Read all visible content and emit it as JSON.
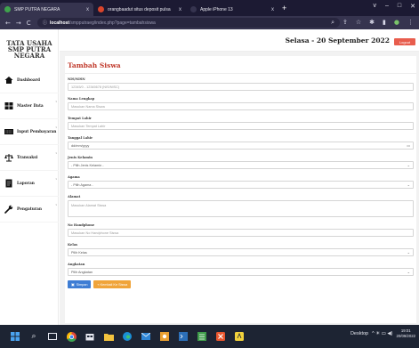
{
  "browser": {
    "tabs": [
      {
        "label": "SMP PUTRA NEGARA",
        "close": "x",
        "favicon_color": "#3fa34d"
      },
      {
        "label": "orangbaadut situs deposit pulsa",
        "close": "x",
        "favicon_color": "#d9452b"
      },
      {
        "label": "Apple iPhone 13",
        "close": "x",
        "favicon_color": "#36344f"
      }
    ],
    "new_tab": "+",
    "window_controls": [
      "v",
      "–",
      "□",
      "✕"
    ],
    "url_host": "localhost",
    "url_path": "/smpputraeg/index.php?page=tambahsiswa",
    "nav": [
      "←",
      "→",
      "C",
      "ⓘ"
    ],
    "toolbar_icons": [
      "search-icon",
      "share-icon",
      "star-icon",
      "extensions-icon",
      "sidebar-icon",
      "profile-icon",
      "menu-icon"
    ]
  },
  "sidebar": {
    "brand": "TATA USAHA SMP PUTRA NEGARA",
    "items": [
      {
        "label": "Dashboard",
        "icon": "home-icon",
        "caret": ""
      },
      {
        "label": "Master Data",
        "icon": "grid-icon",
        "caret": "‹"
      },
      {
        "label": "Input Pembayaran",
        "icon": "keyboard-icon",
        "caret": "‹"
      },
      {
        "label": "Transaksi",
        "icon": "scale-icon",
        "caret": "‹"
      },
      {
        "label": "Laporan",
        "icon": "document-icon",
        "caret": "‹"
      },
      {
        "label": "Pengaturan",
        "icon": "wrench-icon",
        "caret": "‹"
      }
    ]
  },
  "header": {
    "date": "Selasa - 20 September 2022",
    "logout": "Logout"
  },
  "form": {
    "title": "Tambah Siswa",
    "fields": [
      {
        "label": "NIS/NISN",
        "placeholder": "12345/0 - 12345678 (NIS/NISC)"
      },
      {
        "label": "Nama Lengkap",
        "placeholder": "Masukan Nama Siswa"
      },
      {
        "label": "Tempat Lahir",
        "placeholder": "Masukan Tempat Lahir"
      },
      {
        "label": "Tanggal Lahir",
        "placeholder": "dd/mm/yyyy"
      },
      {
        "label": "Jenis Kelamin",
        "placeholder": "- Pilih Jenis Kelamin -"
      },
      {
        "label": "Agama",
        "placeholder": "- Pilih Agama -"
      },
      {
        "label": "Alamat",
        "placeholder": "Masukan Alamat Siswa"
      },
      {
        "label": "No Handphone",
        "placeholder": "Masukan No Handphone Siswa"
      },
      {
        "label": "Kelas",
        "placeholder": "Pilih Kelas"
      },
      {
        "label": "Angkatan",
        "placeholder": "Pilih Angkatan"
      }
    ],
    "save": "Simpan",
    "back": "« Kembali Ke Siswa"
  },
  "taskbar": {
    "apps": [
      "windows-icon",
      "search-icon",
      "task-view-icon",
      "chrome-icon",
      "store-icon",
      "file-explorer-icon",
      "edge-icon",
      "mail-icon",
      "photos-icon",
      "terminal-icon",
      "calculator-icon",
      "xampp-icon",
      "notes-icon"
    ],
    "desktop": "Desktop",
    "tray": "^ ☀ ▭ ◀)",
    "time": "19:01",
    "date": "20/09/2022"
  }
}
